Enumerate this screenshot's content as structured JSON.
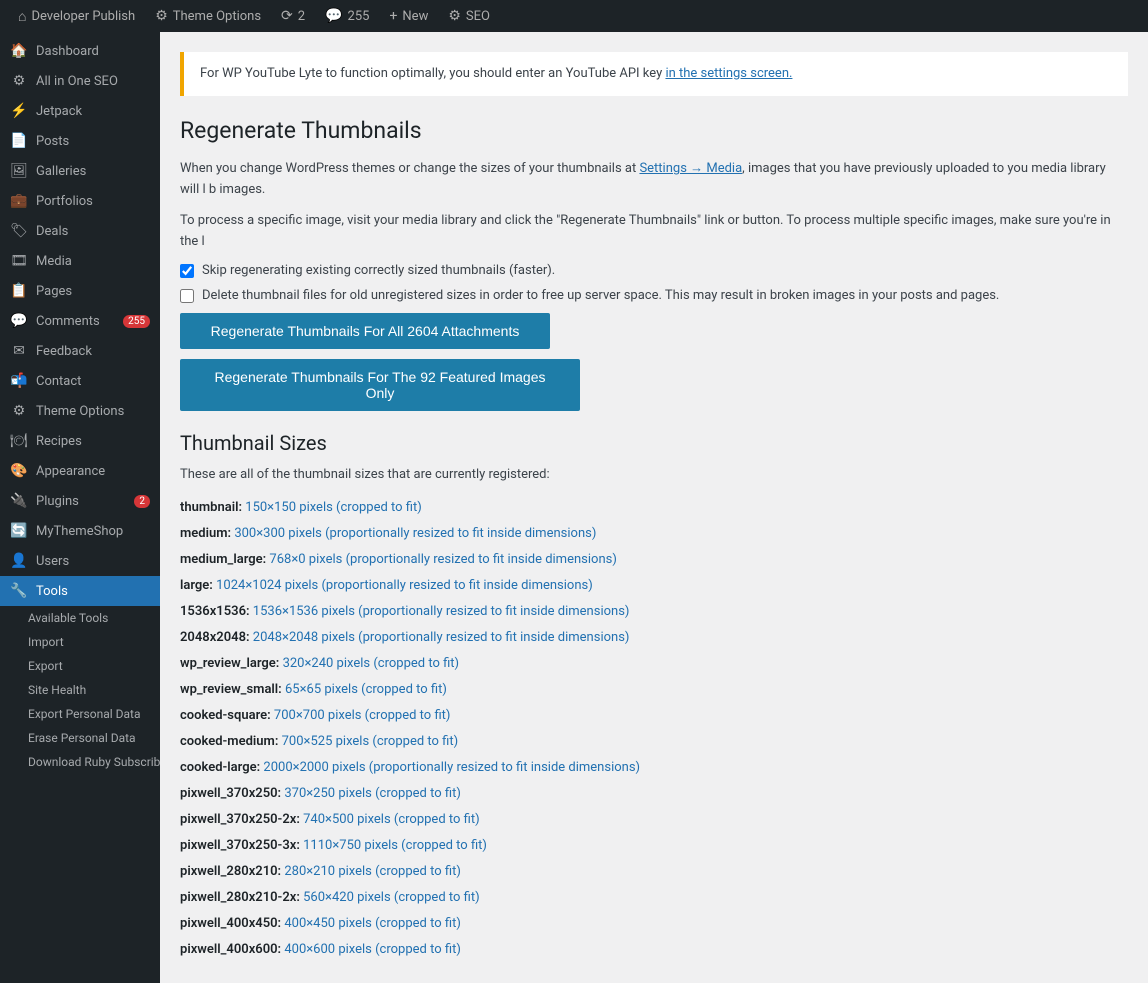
{
  "adminbar": {
    "site_name": "Developer Publish",
    "theme_options": "Theme Options",
    "updates_count": "2",
    "comments_count": "255",
    "new_label": "New",
    "seo_label": "SEO"
  },
  "sidebar": {
    "items": [
      {
        "id": "dashboard",
        "label": "Dashboard",
        "icon": "🏠"
      },
      {
        "id": "allinoneseo",
        "label": "All in One SEO",
        "icon": "⚙"
      },
      {
        "id": "jetpack",
        "label": "Jetpack",
        "icon": "⚡"
      },
      {
        "id": "posts",
        "label": "Posts",
        "icon": "📄"
      },
      {
        "id": "galleries",
        "label": "Galleries",
        "icon": "🖼"
      },
      {
        "id": "portfolios",
        "label": "Portfolios",
        "icon": "💼"
      },
      {
        "id": "deals",
        "label": "Deals",
        "icon": "🏷"
      },
      {
        "id": "media",
        "label": "Media",
        "icon": "🎞"
      },
      {
        "id": "pages",
        "label": "Pages",
        "icon": "📋"
      },
      {
        "id": "comments",
        "label": "Comments",
        "icon": "💬",
        "badge": "255"
      },
      {
        "id": "feedback",
        "label": "Feedback",
        "icon": "✉"
      },
      {
        "id": "contact",
        "label": "Contact",
        "icon": "📬"
      },
      {
        "id": "theme-options",
        "label": "Theme Options",
        "icon": "⚙"
      },
      {
        "id": "recipes",
        "label": "Recipes",
        "icon": "🍽"
      },
      {
        "id": "appearance",
        "label": "Appearance",
        "icon": "🎨"
      },
      {
        "id": "plugins",
        "label": "Plugins",
        "icon": "🔌",
        "badge": "2"
      },
      {
        "id": "mythemeshop",
        "label": "MyThemeShop",
        "icon": "🔄"
      },
      {
        "id": "users",
        "label": "Users",
        "icon": "👤"
      },
      {
        "id": "tools",
        "label": "Tools",
        "icon": "🔧",
        "active": true
      }
    ],
    "submenu": [
      {
        "id": "available-tools",
        "label": "Available Tools"
      },
      {
        "id": "import",
        "label": "Import"
      },
      {
        "id": "export",
        "label": "Export"
      },
      {
        "id": "site-health",
        "label": "Site Health"
      },
      {
        "id": "export-personal",
        "label": "Export Personal Data"
      },
      {
        "id": "erase-personal",
        "label": "Erase Personal Data"
      },
      {
        "id": "download-ruby",
        "label": "Download Ruby Subscribed Emails"
      }
    ]
  },
  "notice": {
    "text_before": "For WP YouTube Lyte to function optimally, you should enter an YouTube API key",
    "link_text": "in the settings screen.",
    "link_href": "#"
  },
  "page": {
    "title": "Regenerate Thumbnails",
    "desc1": "When you change WordPress themes or change the sizes of your thumbnails at",
    "desc1_link": "Settings → Media",
    "desc1_after": ", images that you have previously uploaded to you media library will l b images.",
    "desc2": "To process a specific image, visit your media library and click the \"Regenerate Thumbnails\" link or button. To process multiple specific images, make sure you're in the l",
    "checkbox1_label": "Skip regenerating existing correctly sized thumbnails (faster).",
    "checkbox1_checked": true,
    "checkbox2_label": "Delete thumbnail files for old unregistered sizes in order to free up server space. This may result in broken images in your posts and pages.",
    "checkbox2_checked": false,
    "btn_all_label": "Regenerate Thumbnails For All 2604 Attachments",
    "btn_featured_label": "Regenerate Thumbnails For The 92 Featured Images Only",
    "thumbnail_sizes_title": "Thumbnail Sizes",
    "thumbnail_sizes_desc": "These are all of the thumbnail sizes that are currently registered:",
    "sizes": [
      {
        "label": "thumbnail:",
        "value": "150×150 pixels (cropped to fit)"
      },
      {
        "label": "medium:",
        "value": "300×300 pixels (proportionally resized to fit inside dimensions)"
      },
      {
        "label": "medium_large:",
        "value": "768×0 pixels (proportionally resized to fit inside dimensions)"
      },
      {
        "label": "large:",
        "value": "1024×1024 pixels (proportionally resized to fit inside dimensions)"
      },
      {
        "label": "1536x1536:",
        "value": "1536×1536 pixels (proportionally resized to fit inside dimensions)"
      },
      {
        "label": "2048x2048:",
        "value": "2048×2048 pixels (proportionally resized to fit inside dimensions)"
      },
      {
        "label": "wp_review_large:",
        "value": "320×240 pixels (cropped to fit)"
      },
      {
        "label": "wp_review_small:",
        "value": "65×65 pixels (cropped to fit)"
      },
      {
        "label": "cooked-square:",
        "value": "700×700 pixels (cropped to fit)"
      },
      {
        "label": "cooked-medium:",
        "value": "700×525 pixels (cropped to fit)"
      },
      {
        "label": "cooked-large:",
        "value": "2000×2000 pixels (proportionally resized to fit inside dimensions)"
      },
      {
        "label": "pixwell_370x250:",
        "value": "370×250 pixels (cropped to fit)"
      },
      {
        "label": "pixwell_370x250-2x:",
        "value": "740×500 pixels (cropped to fit)"
      },
      {
        "label": "pixwell_370x250-3x:",
        "value": "1110×750 pixels (cropped to fit)"
      },
      {
        "label": "pixwell_280x210:",
        "value": "280×210 pixels (cropped to fit)"
      },
      {
        "label": "pixwell_280x210-2x:",
        "value": "560×420 pixels (cropped to fit)"
      },
      {
        "label": "pixwell_400x450:",
        "value": "400×450 pixels (cropped to fit)"
      },
      {
        "label": "pixwell_400x600:",
        "value": "400×600 pixels (cropped to fit)"
      }
    ]
  }
}
